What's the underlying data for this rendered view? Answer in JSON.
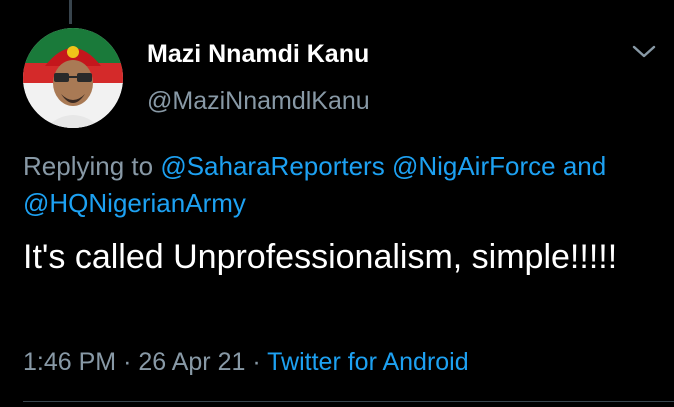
{
  "user": {
    "display_name": "Mazi Nnamdi Kanu",
    "handle": "@MaziNnamdlKanu"
  },
  "reply": {
    "prefix": "Replying to",
    "mention_1": "@SaharaReporters",
    "mention_2": "@NigAirForce",
    "joiner": "and",
    "mention_3": "@HQNigerianArmy"
  },
  "tweet": {
    "text": "It's called Unprofessionalism, simple!!!!!"
  },
  "meta": {
    "time": "1:46 PM",
    "separator": "·",
    "date": "26 Apr 21",
    "source": "Twitter for Android"
  },
  "icons": {
    "menu": "chevron-down-icon",
    "avatar": "profile-photo"
  },
  "colors": {
    "background": "#000000",
    "text": "#ffffff",
    "secondary": "#8899a6",
    "link": "#1da1f2"
  }
}
